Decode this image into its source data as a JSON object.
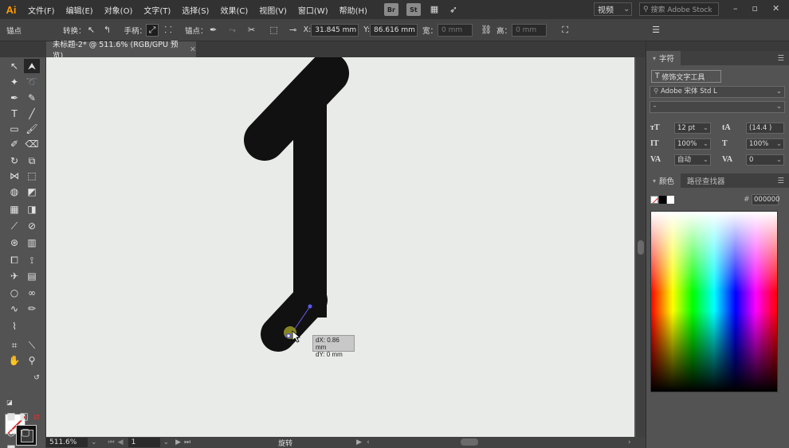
{
  "app": {
    "logo": "Ai"
  },
  "menu": [
    "文件(F)",
    "编辑(E)",
    "对象(O)",
    "文字(T)",
    "选择(S)",
    "效果(C)",
    "视图(V)",
    "窗口(W)",
    "帮助(H)"
  ],
  "appbar": {
    "br": "Br",
    "st": "St",
    "workspace": "视频",
    "stock_placeholder": "搜索 Adobe Stock"
  },
  "control": {
    "anchor_label": "锚点",
    "convert_label": "转换：",
    "handles_label": "手柄：",
    "anchor_points_label": "锚点：",
    "x_label": "X:",
    "x_value": "31.845 mm",
    "y_label": "Y:",
    "y_value": "86.616 mm",
    "w_label": "宽：",
    "w_value": "0 mm",
    "h_label": "高：",
    "h_value": "0 mm"
  },
  "document": {
    "tab_title": "未标题-2* @ 511.6% (RGB/GPU 预览)"
  },
  "status": {
    "zoom": "511.6%",
    "page": "1",
    "mode": "旋转"
  },
  "tooltip": {
    "dx": "dX: 0.86 mm",
    "dy": "dY: 0 mm"
  },
  "char_panel": {
    "title": "字符",
    "touch_tool": "修饰文字工具",
    "font_family": "Adobe 宋体 Std L",
    "font_style": "-",
    "font_size": "12 pt",
    "leading": "(14.4 )",
    "vscale": "100%",
    "hscale": "100%",
    "kerning": "自动",
    "tracking": "0"
  },
  "color_panel": {
    "title": "颜色",
    "tab2": "路径查找器",
    "hex_label": "#",
    "hex": "000000"
  }
}
